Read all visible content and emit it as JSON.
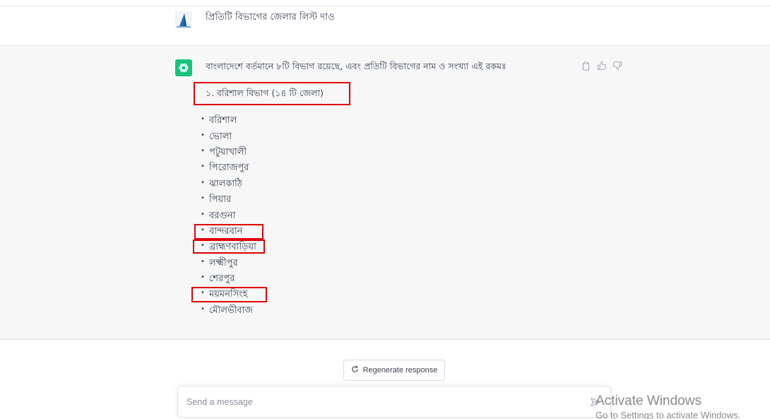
{
  "user_message": {
    "avatar_icon": "user-avatar-icon",
    "text": "প্রিতিটি বিভাগের জেলার লিস্ট দাও"
  },
  "assistant_message": {
    "avatar_icon": "openai-logo-icon",
    "intro": "বাংলাদেশে বর্তমানে ৮টি বিভাগ রয়েছে, এবং প্রতিটি বিভাগের নাম ও সংখ্যা এই রকমঃ",
    "section_heading": "১. বরিশাল বিভাগ (১৪ টি জেলা)",
    "districts": [
      "বরিশাল",
      "ভোলা",
      "পটুয়াখালী",
      "পিরোজপুর",
      "ঝালকাঠি",
      "পিয়ার",
      "বরগুনা",
      "বান্দরবান",
      "ব্রাহ্মণবাড়িয়া",
      "লক্ষ্মীপুর",
      "শেরপুর",
      "ময়মনসিংহ",
      "মৌলভীবাজ"
    ],
    "actions": [
      "copy-icon",
      "thumbs-up-icon",
      "thumbs-down-icon"
    ]
  },
  "regenerate": {
    "label": "Regenerate response",
    "icon": "refresh-icon"
  },
  "composer": {
    "placeholder": "Send a message",
    "value": "",
    "send_icon": "send-icon"
  },
  "watermark": {
    "line1": "Activate Windows",
    "line2": "Go to Settings to activate Windows."
  },
  "colors": {
    "accent_green": "#19c37d",
    "highlight_red": "#e10000",
    "assistant_bg": "#f7f7f8"
  }
}
